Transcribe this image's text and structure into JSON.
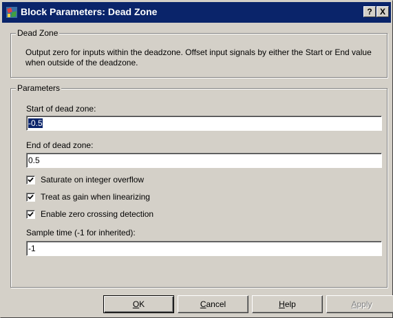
{
  "window": {
    "title": "Block Parameters: Dead Zone",
    "help_button": "?",
    "close_button": "X"
  },
  "dead_zone_group": {
    "title": "Dead Zone",
    "description": "Output zero for inputs within the deadzone.  Offset input signals by either the Start or End value when outside of the deadzone."
  },
  "parameters_group": {
    "title": "Parameters",
    "start_label": "Start of dead zone:",
    "start_value": "-0.5",
    "end_label": "End of dead zone:",
    "end_value": "0.5",
    "saturate_label": "Saturate on integer overflow",
    "saturate_checked": true,
    "gain_label": "Treat as gain when linearizing",
    "gain_checked": true,
    "zero_crossing_label": "Enable zero crossing detection",
    "zero_crossing_checked": true,
    "sample_time_label": "Sample time (-1 for inherited):",
    "sample_time_value": "-1"
  },
  "buttons": {
    "ok_accel": "O",
    "ok_rest": "K",
    "cancel_accel": "C",
    "cancel_rest": "ancel",
    "help_accel": "H",
    "help_rest": "elp",
    "apply_accel": "A",
    "apply_rest": "pply"
  }
}
